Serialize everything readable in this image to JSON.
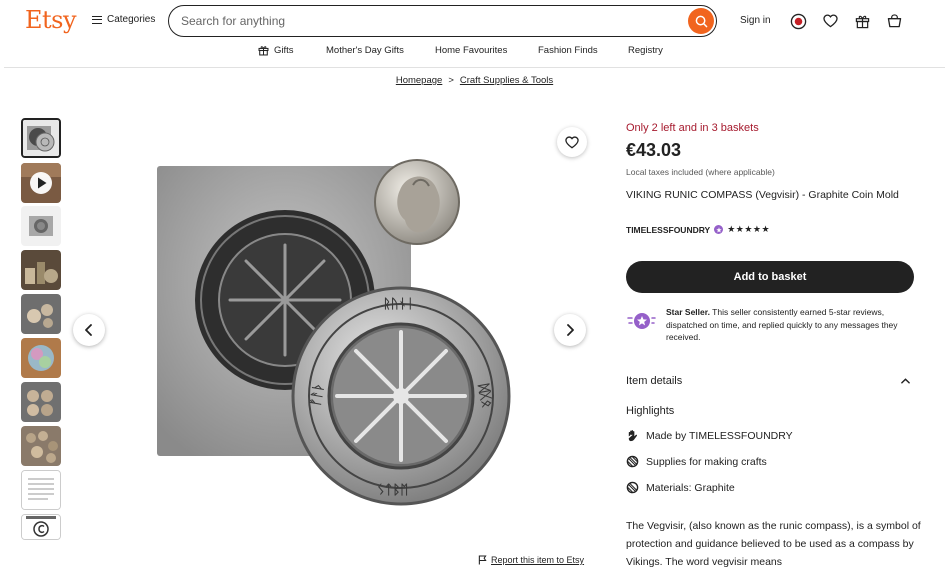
{
  "header": {
    "logo": "Etsy",
    "categories_label": "Categories",
    "search_placeholder": "Search for anything",
    "signin_label": "Sign in"
  },
  "nav": {
    "items": [
      "Gifts",
      "Mother's Day Gifts",
      "Home Favourites",
      "Fashion Finds",
      "Registry"
    ]
  },
  "breadcrumb": {
    "items": [
      "Homepage",
      "Craft Supplies & Tools"
    ],
    "separator": ">"
  },
  "gallery": {
    "thumbnail_count": 10,
    "report_label": "Report this item to Etsy"
  },
  "product": {
    "stock_notice": "Only 2 left and in 3 baskets",
    "price": "€43.03",
    "tax_note": "Local taxes included (where applicable)",
    "title": "VIKING RUNIC COMPASS (Vegvisir) - Graphite Coin Mold",
    "shop_name": "TIMELESSFOUNDRY",
    "rating_stars": "★★★★★",
    "add_to_basket_label": "Add to basket",
    "star_seller": {
      "heading": "Star Seller.",
      "text": " This seller consistently earned 5-star reviews, dispatched on time, and replied quickly to any messages they received."
    },
    "item_details_label": "Item details",
    "highlights_label": "Highlights",
    "highlights": {
      "made_by_prefix": "Made by ",
      "made_by_shop": "TIMELESSFOUNDRY",
      "supplies": "Supplies for making crafts",
      "materials": "Materials: Graphite"
    },
    "description": "The Vegvisir, (also known as the runic compass), is a symbol of protection and guidance believed to be used as a compass by Vikings. The word vegvisir means"
  },
  "colors": {
    "brand": "#f1641e",
    "stock_red": "#a61a2e",
    "button_dark": "#222222",
    "star_seller_purple": "#9560c9"
  }
}
